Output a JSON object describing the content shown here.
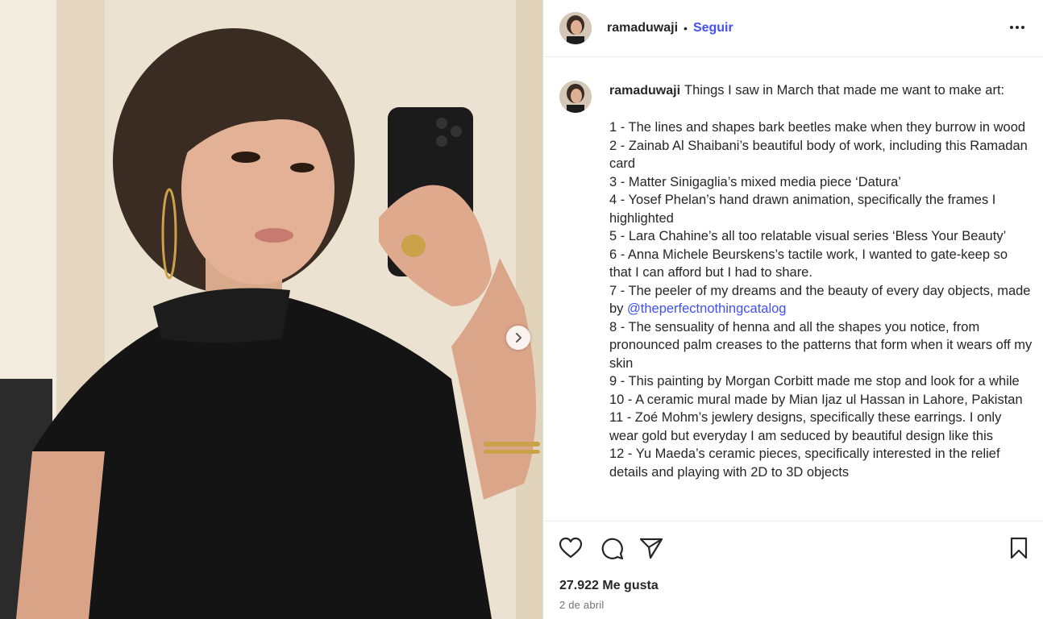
{
  "post": {
    "username": "ramaduwaji",
    "separator": "•",
    "follow_label": "Seguir",
    "more_icon": "more-horizontal-icon"
  },
  "caption": {
    "username": "ramaduwaji",
    "intro": "Things I saw in March that made me want to make art:",
    "items": [
      "1 - The lines and shapes bark beetles make when they burrow in wood",
      "2 - Zainab Al Shaibani’s beautiful body of work, including this Ramadan card",
      "3 - Matter Sinigaglia’s mixed media piece ‘Datura’",
      "4 - Yosef Phelan’s hand drawn animation, specifically the frames I highlighted",
      "5 - Lara Chahine’s all too relatable visual series ‘Bless Your Beauty’",
      "6 - Anna Michele Beurskens’s tactile work, I wanted to gate-keep so that I can afford but I had to share.",
      "8 - The sensuality of henna and all the shapes you notice, from pronounced palm creases to the patterns that form when it wears off my skin",
      "9 - This painting by Morgan Corbitt made me stop and look for a while",
      "10 - A ceramic mural made by Mian Ijaz ul Hassan in Lahore, Pakistan",
      "11 - Zoé Mohm’s jewlery designs, specifically these earrings. I only wear gold but everyday I am seduced by beautiful design like this",
      "12 - Yu Maeda’s ceramic pieces, specifically interested in the relief details and playing with 2D to 3D objects"
    ],
    "item7_prefix": "7 - The peeler of my dreams and the beauty of every day objects, made by ",
    "item7_mention": "@theperfectnothingcatalog"
  },
  "stats": {
    "likes": "27.922 Me gusta",
    "date": "2 de abril"
  },
  "icons": {
    "like": "heart-icon",
    "comment": "comment-icon",
    "share": "share-icon",
    "save": "bookmark-icon",
    "next": "chevron-right-icon"
  }
}
